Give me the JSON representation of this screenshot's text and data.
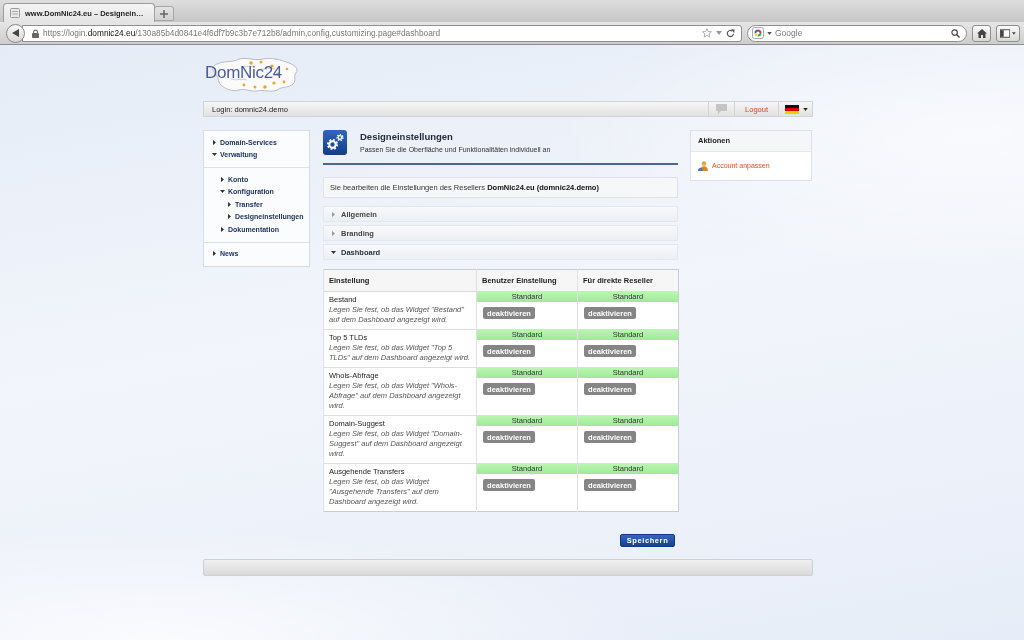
{
  "browser": {
    "tab_title": "www.DomNic24.eu – Designein…",
    "url": "https://login.**domnic24.eu**/130a85b4d0841e4f6df7b9c3b7e712b8/admin,config,customizing.page#dashboard",
    "search": {
      "placeholder": "Google"
    }
  },
  "header": {
    "logo": "DomNic24",
    "login": "Login: domnic24.demo",
    "logout": "Logout"
  },
  "sidebar": {
    "items": [
      {
        "label": "Domain-Services",
        "expanded": false
      },
      {
        "label": "Verwaltung",
        "expanded": true,
        "children": [
          {
            "label": "Konto",
            "expanded": false
          },
          {
            "label": "Konfiguration",
            "expanded": true,
            "children": [
              {
                "label": "Transfer",
                "expanded": false
              },
              {
                "label": "Designeinstellungen",
                "expanded": false
              }
            ]
          },
          {
            "label": "Dokumentation",
            "expanded": false
          }
        ]
      },
      {
        "label": "News",
        "expanded": false
      }
    ]
  },
  "page": {
    "title": "Designeinstellungen",
    "subtitle": "Passen Sie die Oberfläche und Funktionalitäten individuell an",
    "notice": "Sie bearbeiten die Einstellungen des Resellers **DomNic24.eu (domnic24.demo)**"
  },
  "sections": [
    {
      "label": "Allgemein",
      "expanded": false
    },
    {
      "label": "Branding",
      "expanded": false
    },
    {
      "label": "Dashboard",
      "expanded": true
    }
  ],
  "table": {
    "columns": [
      "Einstellung",
      "Benutzer Einstellung",
      "Für direkte Reseller"
    ],
    "rows": [
      {
        "cells": [
          {
            "kind": "setting",
            "name": "Bestand",
            "description": "Legen Sie fest, ob das Widget \"Bestand\" auf dem Dashboard angezeigt wird."
          },
          {
            "kind": "toggle",
            "status": "Standard",
            "button": {
              "label": "deaktivieren",
              "disabled": true
            }
          },
          {
            "kind": "toggle",
            "status": "Standard",
            "button": {
              "label": "deaktivieren",
              "disabled": true
            }
          }
        ]
      },
      {
        "cells": [
          {
            "kind": "setting",
            "name": "Top 5 TLDs",
            "description": "Legen Sie fest, ob das Widget \"Top 5 TLDs\" auf dem Dashboard angezeigt wird."
          },
          {
            "kind": "toggle",
            "status": "Standard",
            "button": {
              "label": "deaktivieren",
              "disabled": true
            }
          },
          {
            "kind": "toggle",
            "status": "Standard",
            "button": {
              "label": "deaktivieren",
              "disabled": true
            }
          }
        ]
      },
      {
        "cells": [
          {
            "kind": "setting",
            "name": "Whois-Abfrage",
            "description": "Legen Sie fest, ob das Widget \"Whois-Abfrage\" auf dem Dashboard angezeigt wird."
          },
          {
            "kind": "toggle",
            "status": "Standard",
            "button": {
              "label": "deaktivieren",
              "disabled": true
            }
          },
          {
            "kind": "toggle",
            "status": "Standard",
            "button": {
              "label": "deaktivieren",
              "disabled": true
            }
          }
        ]
      },
      {
        "cells": [
          {
            "kind": "setting",
            "name": "Domain-Suggest",
            "description": "Legen Sie fest, ob das Widget \"Domain-Suggest\" auf dem Dashboard angezeigt wird."
          },
          {
            "kind": "toggle",
            "status": "Standard",
            "button": {
              "label": "deaktivieren",
              "disabled": true
            }
          },
          {
            "kind": "toggle",
            "status": "Standard",
            "button": {
              "label": "deaktivieren",
              "disabled": true
            }
          }
        ]
      },
      {
        "cells": [
          {
            "kind": "setting",
            "name": "Ausgehende Transfers",
            "description": "Legen Sie fest, ob das Widget \"Ausgehende Transfers\" auf dem Dashboard angezeigt wird."
          },
          {
            "kind": "toggle",
            "status": "Standard",
            "button": {
              "label": "deaktivieren",
              "disabled": true
            }
          },
          {
            "kind": "toggle",
            "status": "Standard",
            "button": {
              "label": "deaktivieren",
              "disabled": true
            }
          }
        ]
      }
    ]
  },
  "save_button": "Speichern",
  "actions": {
    "title": "Aktionen",
    "items": [
      {
        "label": "Account anpassen"
      }
    ]
  }
}
